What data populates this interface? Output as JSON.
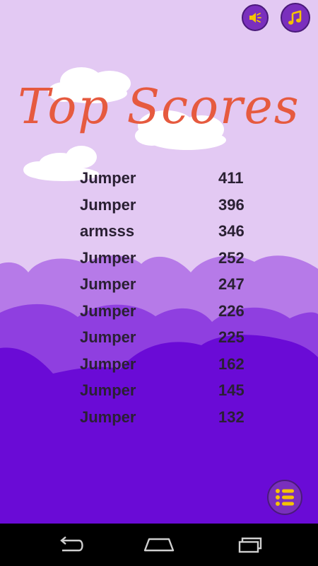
{
  "title": "Top Scores",
  "icons": {
    "sound": "speaker-icon",
    "music": "music-note-icon",
    "menu": "list-menu-icon",
    "back": "back-arrow-icon",
    "home": "home-icon",
    "recents": "recent-apps-icon"
  },
  "scores": [
    {
      "name": "Jumper",
      "score": "411"
    },
    {
      "name": "Jumper",
      "score": "396"
    },
    {
      "name": "armsss",
      "score": "346"
    },
    {
      "name": "Jumper",
      "score": "252"
    },
    {
      "name": "Jumper",
      "score": "247"
    },
    {
      "name": "Jumper",
      "score": "226"
    },
    {
      "name": "Jumper",
      "score": "225"
    },
    {
      "name": "Jumper",
      "score": "162"
    },
    {
      "name": "Jumper",
      "score": "145"
    },
    {
      "name": "Jumper",
      "score": "132"
    }
  ],
  "colors": {
    "sky": "#e3c9f3",
    "hills_light": "#b67ae8",
    "hills_mid": "#8f3fe0",
    "hills_dark": "#6a0bd6",
    "title": "#e65a3f",
    "button": "#7a2fbd",
    "button_glyph": "#f5c400"
  }
}
